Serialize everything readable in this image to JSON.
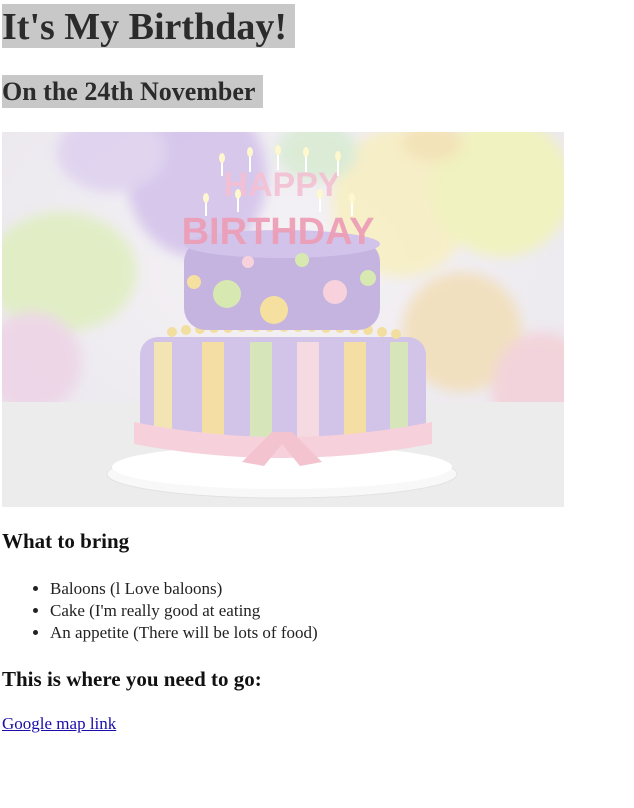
{
  "header": {
    "title": "It's My Birthday!",
    "subtitle": "On the 24th November"
  },
  "photo": {
    "cake_topper_line1": "HAPPY",
    "cake_topper_line2": "BIRTHDAY"
  },
  "bring": {
    "heading": "What to bring",
    "items": [
      "Baloons (l Love baloons)",
      "Cake (I'm really good at eating",
      "An appetite (There will be lots of food)"
    ]
  },
  "directions": {
    "heading": "This is where you need to go:",
    "link_label": "Google map link"
  },
  "colors": {
    "title_background": "#c8c8c8",
    "link": "#1a0dab"
  }
}
